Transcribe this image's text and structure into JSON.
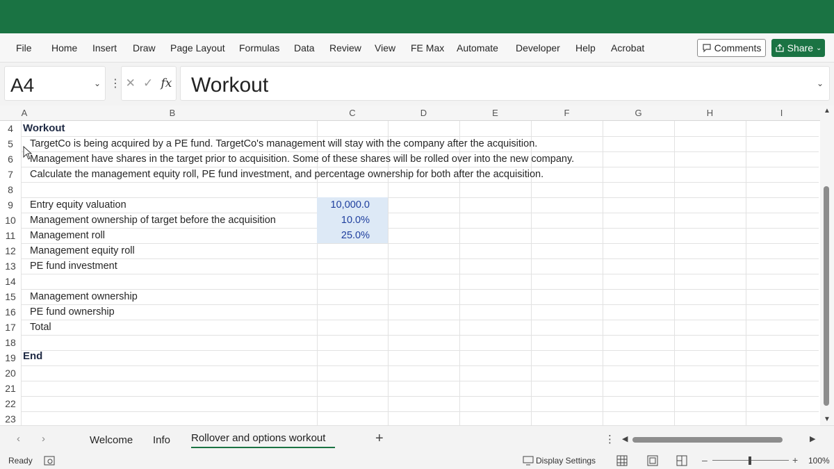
{
  "menu": {
    "items": [
      "File",
      "Home",
      "Insert",
      "Draw",
      "Page Layout",
      "Formulas",
      "Data",
      "Review",
      "View",
      "FE Max",
      "Automate",
      "Developer",
      "Help",
      "Acrobat"
    ],
    "comments_label": "Comments",
    "share_label": "Share"
  },
  "formula_bar": {
    "name_box": "A4",
    "content": "Workout"
  },
  "columns": [
    "A",
    "B",
    "C",
    "D",
    "E",
    "F",
    "G",
    "H",
    "I"
  ],
  "rows": [
    "4",
    "5",
    "6",
    "7",
    "8",
    "9",
    "10",
    "11",
    "12",
    "13",
    "14",
    "15",
    "16",
    "17",
    "18",
    "19",
    "20",
    "21",
    "22",
    "23"
  ],
  "cells": {
    "r4": "Workout",
    "r5": "TargetCo is being acquired by a PE fund. TargetCo's management will stay with the company after the acquisition.",
    "r6": "Management have shares in the target prior to acquisition. Some of these shares will be rolled over into the new company.",
    "r7": "Calculate the management equity roll, PE fund investment, and percentage ownership for both after the acquisition.",
    "r9": "Entry equity valuation",
    "r10": "Management ownership of target before the acquisition",
    "r11": "Management roll",
    "r12": "Management equity roll",
    "r13": "PE fund investment",
    "r15": "Management ownership",
    "r16": "PE fund ownership",
    "r17": "Total",
    "r19": "End",
    "c9": "10,000.0",
    "c10": "10.0%",
    "c11": "25.0%"
  },
  "sheet_tabs": [
    "Welcome",
    "Info",
    "Rollover and options workout"
  ],
  "active_tab": "Rollover and options workout",
  "status": {
    "ready": "Ready",
    "display_settings": "Display Settings",
    "zoom": "100%"
  },
  "colors": {
    "brand": "#1a7343",
    "input_fill": "#dde9f6",
    "input_text": "#1f3f9e"
  }
}
